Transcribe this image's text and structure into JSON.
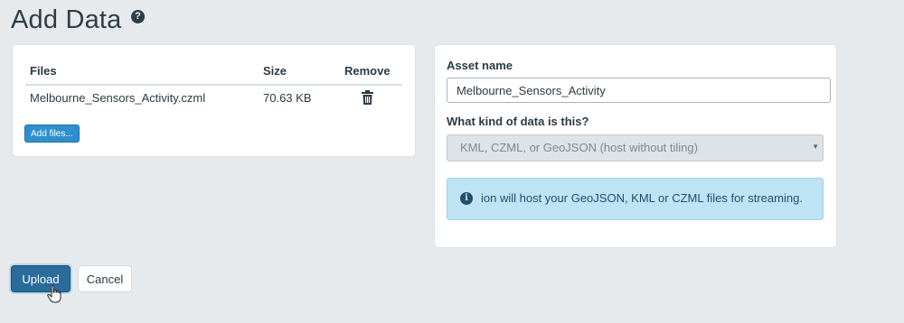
{
  "page": {
    "title": "Add Data",
    "help_icon": "question-circle-icon"
  },
  "files_panel": {
    "columns": [
      "Files",
      "Size",
      "Remove"
    ],
    "rows": [
      {
        "name": "Melbourne_Sensors_Activity.czml",
        "size": "70.63 KB",
        "remove_icon": "trash-icon"
      }
    ],
    "add_files_label": "Add files..."
  },
  "asset_panel": {
    "asset_name_label": "Asset name",
    "asset_name_value": "Melbourne_Sensors_Activity",
    "kind_label": "What kind of data is this?",
    "kind_value": "KML, CZML, or GeoJSON (host without tiling)",
    "info_text": "ion will host your GeoJSON, KML or CZML files for streaming.",
    "info_icon": "info-circle-icon"
  },
  "actions": {
    "upload_label": "Upload",
    "cancel_label": "Cancel"
  },
  "colors": {
    "primary_button": "#2a6c9c",
    "info_background": "#bde3f5",
    "page_background": "#e6eaed"
  }
}
